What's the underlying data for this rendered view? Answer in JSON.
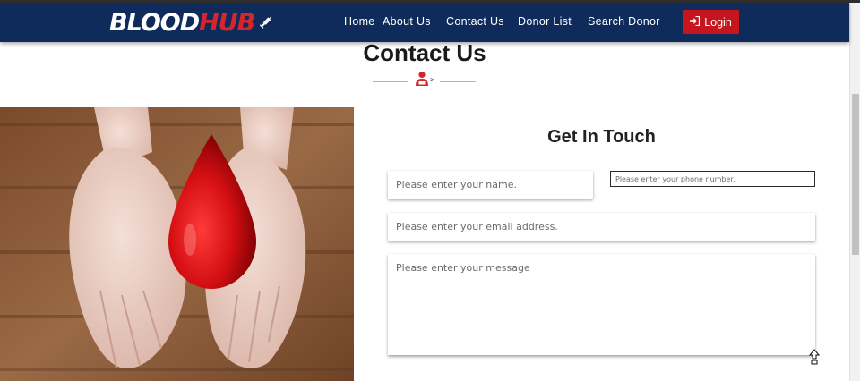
{
  "brand": {
    "blood": "BLOOD",
    "hub": "HUB"
  },
  "nav": {
    "items": [
      {
        "label": "Home"
      },
      {
        "label": "About Us"
      },
      {
        "label": "Contact Us"
      },
      {
        "label": "Donor List"
      },
      {
        "label": "Search Donor"
      }
    ],
    "login_label": "Login",
    "login_icon": "sign-in-icon"
  },
  "page": {
    "title": "Contact Us",
    "divider_icon": "blood-donor-icon",
    "divider_arrow": ">"
  },
  "form": {
    "title": "Get In Touch",
    "name_placeholder": "Please enter your name.",
    "phone_placeholder": "Please enter your phone number.",
    "email_placeholder": "Please enter your email address.",
    "message_placeholder": "Please enter your message"
  },
  "colors": {
    "navbar": "#0f2b5b",
    "brand_accent": "#d6262c",
    "login_button": "#c4161c"
  }
}
